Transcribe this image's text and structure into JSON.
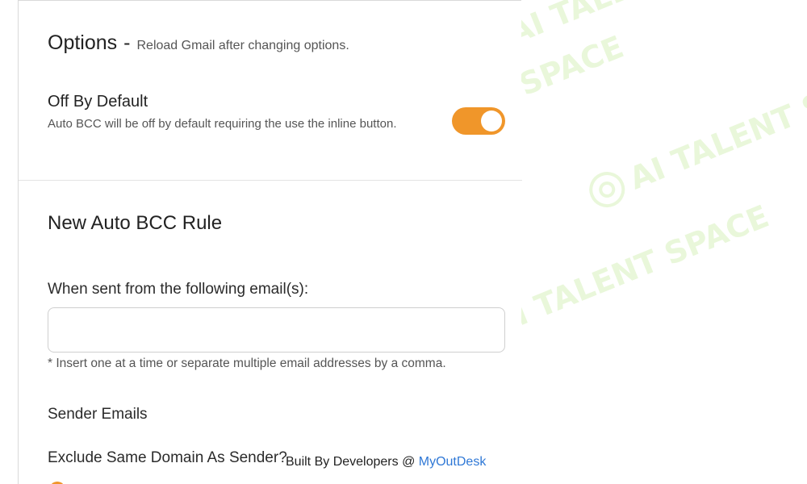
{
  "options": {
    "title": "Options",
    "dash": "-",
    "note": "Reload Gmail after changing options."
  },
  "off_by_default": {
    "title": "Off By Default",
    "description": "Auto BCC will be off by default requiring the use the inline button.",
    "enabled": true
  },
  "new_rule": {
    "title": "New Auto BCC Rule",
    "sent_from_label": "When sent from the following email(s):",
    "email_input_value": "",
    "helper_text": "* Insert one at a time or separate multiple email addresses by a comma.",
    "sender_emails_label": "Sender Emails",
    "exclude_label": "Exclude Same Domain As Sender?"
  },
  "footer": {
    "text": "Built By Developers @ ",
    "link_label": "MyOutDesk"
  },
  "watermark": {
    "text": "AI TALENT SPACE"
  },
  "colors": {
    "toggle_on": "#f0962a",
    "link": "#2f78d6",
    "watermark": "#bae68c"
  }
}
